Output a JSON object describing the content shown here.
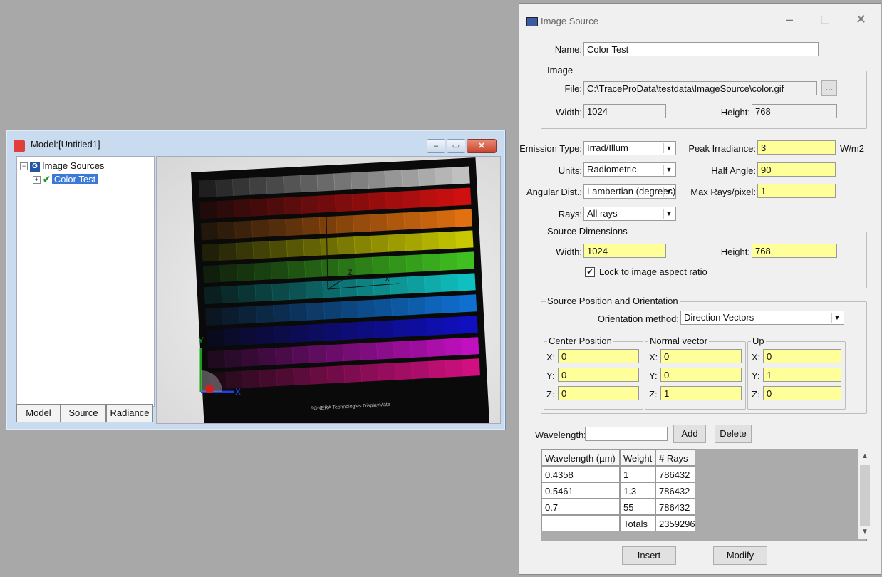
{
  "model_window": {
    "title": "Model:[Untitled1]",
    "tree": {
      "root_label": "Image Sources",
      "child_label": "Color Test"
    },
    "tabs": [
      "Model",
      "Source",
      "Radiance"
    ],
    "buttons": {
      "minimize": "–",
      "maximize": "▭",
      "close": "✕"
    }
  },
  "viewport": {
    "axes": {
      "x": "X",
      "y": "Y",
      "z": "Z"
    },
    "chart_rows": [
      "#c0c0c0",
      "#d01010",
      "#e07010",
      "#c8c800",
      "#40c020",
      "#10c0c0",
      "#1070d0",
      "#1010c0",
      "#c010c0",
      "#d01080"
    ],
    "footer_texts": [
      "SONERA Technologies DisplayMate"
    ]
  },
  "dialog": {
    "title": "Image Source",
    "controls": {
      "minimize": "–",
      "maximize": "□",
      "close": "✕"
    },
    "name_label": "Name:",
    "name_value": "Color Test",
    "image_group": "Image",
    "file_label": "File:",
    "file_value": "C:\\TraceProData\\testdata\\ImageSource\\color.gif",
    "browse_label": "...",
    "width_label": "Width:",
    "width_value": "1024",
    "height_label": "Height:",
    "height_value": "768",
    "emission_label": "Emission Type:",
    "emission_value": "Irrad/Illum",
    "units_label": "Units:",
    "units_value": "Radiometric",
    "angular_label": "Angular Dist.:",
    "angular_value": "Lambertian (degrees)",
    "rays_label": "Rays:",
    "rays_value": "All rays",
    "peak_label": "Peak Irradiance:",
    "peak_value": "3",
    "peak_unit": "W/m2",
    "half_label": "Half Angle:",
    "half_value": "90",
    "maxrays_label": "Max Rays/pixel:",
    "maxrays_value": "1",
    "srcdim_group": "Source Dimensions",
    "src_width_label": "Width:",
    "src_width_value": "1024",
    "src_height_label": "Height:",
    "src_height_value": "768",
    "lock_label": "Lock to image aspect ratio",
    "lock_checked": "✔",
    "pos_group": "Source Position and Orientation",
    "orient_label": "Orientation method:",
    "orient_value": "Direction Vectors",
    "center_group": "Center Position",
    "normal_group": "Normal vector",
    "up_group": "Up",
    "center": {
      "x": "0",
      "y": "0",
      "z": "0"
    },
    "normal": {
      "x": "0",
      "y": "0",
      "z": "1"
    },
    "up": {
      "x": "0",
      "y": "1",
      "z": "0"
    },
    "xyz_labels": {
      "x": "X:",
      "y": "Y:",
      "z": "Z:"
    },
    "wavelength_label": "Wavelength:",
    "wavelength_value": "",
    "add_label": "Add",
    "delete_label": "Delete",
    "table": {
      "headers": [
        "Wavelength (µm)",
        "Weight",
        "# Rays"
      ],
      "rows": [
        [
          "0.4358",
          "1",
          "786432"
        ],
        [
          "0.5461",
          "1.3",
          "786432"
        ],
        [
          "0.7",
          "55",
          "786432"
        ],
        [
          "",
          "Totals",
          "2359296"
        ]
      ]
    },
    "insert_label": "Insert",
    "modify_label": "Modify"
  }
}
